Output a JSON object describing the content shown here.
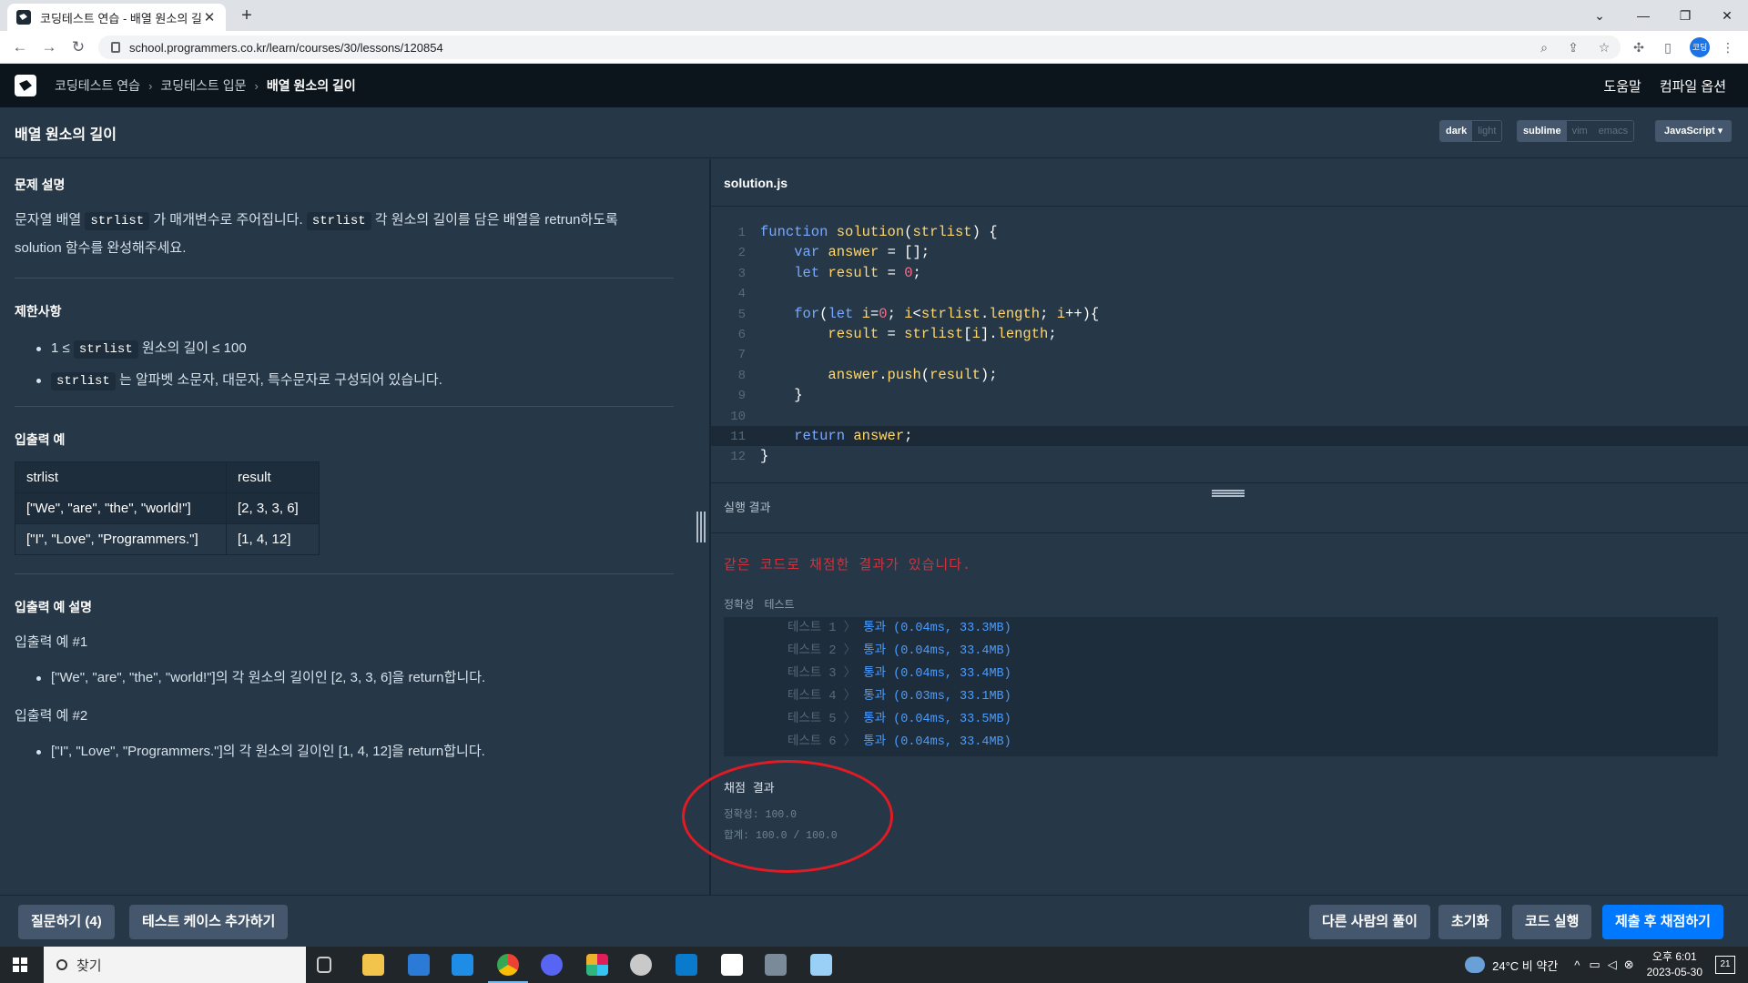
{
  "browser": {
    "tab_title": "코딩테스트 연습 - 배열 원소의 길",
    "tab_close": "✕",
    "new_tab": "+",
    "url": "school.programmers.co.kr/learn/courses/30/lessons/120854",
    "profile_initials": "코딩"
  },
  "header": {
    "breadcrumbs": [
      "코딩테스트 연습",
      "코딩테스트 입문",
      "배열 원소의 길이"
    ],
    "help": "도움말",
    "compile_options": "컴파일 옵션"
  },
  "titlebar": {
    "title": "배열 원소의 길이",
    "theme": [
      "dark",
      "light"
    ],
    "keymap": [
      "sublime",
      "vim",
      "emacs"
    ],
    "language": "JavaScript ▾"
  },
  "problem": {
    "desc_heading": "문제 설명",
    "desc": [
      "문자열 배열",
      "strlist",
      "가 매개변수로 주어집니다.",
      "strlist",
      "각 원소의 길이를 담은 배열을 retrun하도록",
      "solution 함수를 완성해주세요."
    ],
    "limits_heading": "제한사항",
    "limits": [
      [
        "1 ≤",
        "strlist",
        "원소의 길이 ≤ 100"
      ],
      [
        "",
        "strlist",
        "는 알파벳 소문자, 대문자, 특수문자로 구성되어 있습니다."
      ]
    ],
    "io_heading": "입출력 예",
    "io_columns": [
      "strlist",
      "result"
    ],
    "io_rows": [
      [
        "[\"We\", \"are\", \"the\", \"world!\"]",
        "[2, 3, 3, 6]"
      ],
      [
        "[\"I\", \"Love\", \"Programmers.\"]",
        "[1, 4, 12]"
      ]
    ],
    "explain_heading": "입출력 예 설명",
    "explain": [
      {
        "label": "입출력 예 #1",
        "text": "[\"We\", \"are\", \"the\", \"world!\"]의 각 원소의 길이인 [2, 3, 3, 6]을 return합니다."
      },
      {
        "label": "입출력 예 #2",
        "text": "[\"I\", \"Love\", \"Programmers.\"]의 각 원소의 길이인 [1, 4, 12]을 return합니다."
      }
    ]
  },
  "editor": {
    "filename": "solution.js",
    "line_numbers": [
      "1",
      "2",
      "3",
      "4",
      "5",
      "6",
      "7",
      "8",
      "9",
      "10",
      "11",
      "12"
    ]
  },
  "result": {
    "heading": "실행 결과",
    "message": "같은 코드로 채점한 결과가 있습니다.",
    "tabs": "정확성  테스트",
    "tests": [
      {
        "name": "테스트 1",
        "value": "통과 (0.04ms, 33.3MB)"
      },
      {
        "name": "테스트 2",
        "value": "통과 (0.04ms, 33.4MB)"
      },
      {
        "name": "테스트 3",
        "value": "통과 (0.04ms, 33.4MB)"
      },
      {
        "name": "테스트 4",
        "value": "통과 (0.03ms, 33.1MB)"
      },
      {
        "name": "테스트 5",
        "value": "통과 (0.04ms, 33.5MB)"
      },
      {
        "name": "테스트 6",
        "value": "통과 (0.04ms, 33.4MB)"
      }
    ],
    "separator": "〉",
    "grade_heading": "채점 결과",
    "accuracy": "정확성: 100.0",
    "total": "합계: 100.0 / 100.0"
  },
  "bottom": {
    "ask": "질문하기 (4)",
    "add_case": "테스트 케이스 추가하기",
    "others": "다른 사람의 풀이",
    "reset": "초기화",
    "run": "코드 실행",
    "submit": "제출 후 채점하기"
  },
  "taskbar": {
    "search": "찾기",
    "weather": "24°C  비 약간",
    "time": "오후 6:01",
    "date": "2023-05-30",
    "notif": "21"
  },
  "colors": {
    "accent": "#0078ff",
    "pass": "#4a9cff",
    "error": "#d3323c",
    "bg": "#263747"
  }
}
